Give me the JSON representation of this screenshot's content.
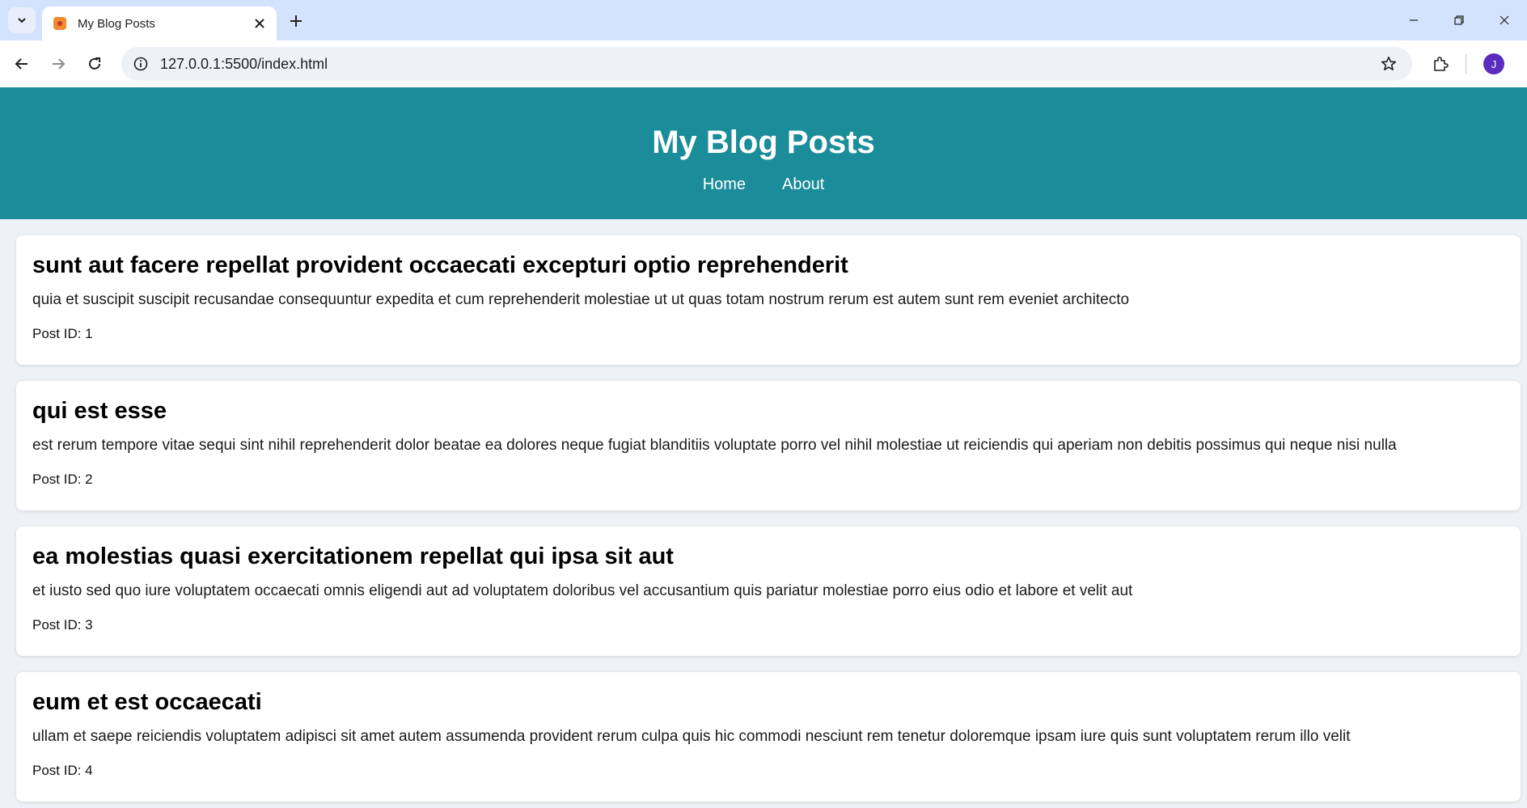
{
  "browser": {
    "tab_title": "My Blog Posts",
    "url": "127.0.0.1:5500/index.html",
    "avatar_initial": "J"
  },
  "header": {
    "title": "My Blog Posts",
    "nav": [
      {
        "label": "Home"
      },
      {
        "label": "About"
      }
    ]
  },
  "colors": {
    "header_bg": "#1b8c9a",
    "page_bg": "#eef1f5",
    "tabbar_bg": "#d3e3fd"
  },
  "posts": [
    {
      "title": "sunt aut facere repellat provident occaecati excepturi optio reprehenderit",
      "body": "quia et suscipit suscipit recusandae consequuntur expedita et cum reprehenderit molestiae ut ut quas totam nostrum rerum est autem sunt rem eveniet architecto",
      "id_label": "Post ID: 1"
    },
    {
      "title": "qui est esse",
      "body": "est rerum tempore vitae sequi sint nihil reprehenderit dolor beatae ea dolores neque fugiat blanditiis voluptate porro vel nihil molestiae ut reiciendis qui aperiam non debitis possimus qui neque nisi nulla",
      "id_label": "Post ID: 2"
    },
    {
      "title": "ea molestias quasi exercitationem repellat qui ipsa sit aut",
      "body": "et iusto sed quo iure voluptatem occaecati omnis eligendi aut ad voluptatem doloribus vel accusantium quis pariatur molestiae porro eius odio et labore et velit aut",
      "id_label": "Post ID: 3"
    },
    {
      "title": "eum et est occaecati",
      "body": "ullam et saepe reiciendis voluptatem adipisci sit amet autem assumenda provident rerum culpa quis hic commodi nesciunt rem tenetur doloremque ipsam iure quis sunt voluptatem rerum illo velit",
      "id_label": "Post ID: 4"
    }
  ]
}
